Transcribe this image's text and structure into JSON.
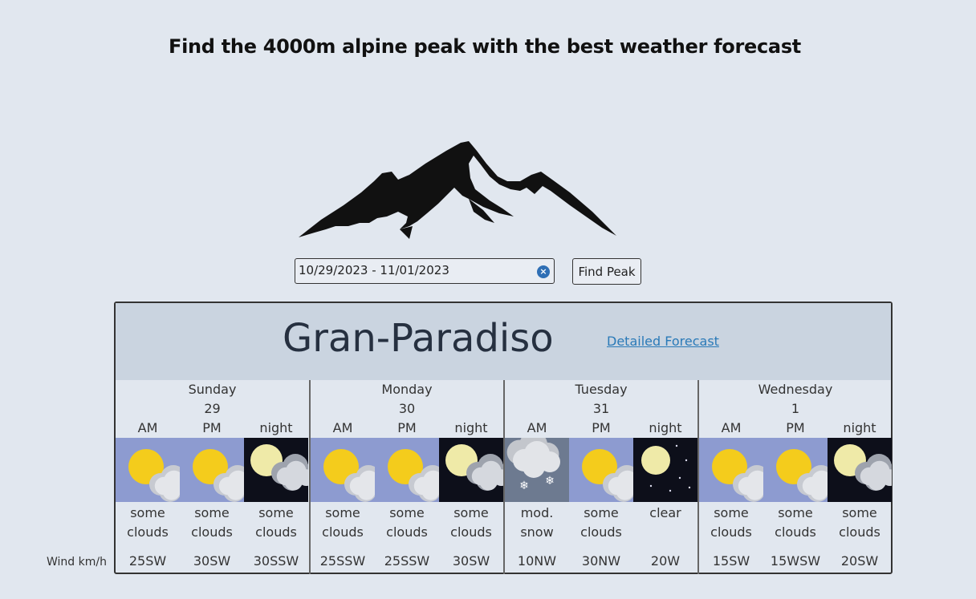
{
  "page": {
    "title": "Find the 4000m alpine peak with the best weather forecast"
  },
  "search": {
    "date_range": "10/29/2023 - 11/01/2023",
    "clear_icon": "clear-icon",
    "find_label": "Find Peak"
  },
  "result": {
    "peak_name": "Gran-Paradiso",
    "detail_link": "Detailed Forecast",
    "wind_label": "Wind km/h",
    "days": [
      {
        "name": "Sunday",
        "date": "29",
        "periods": [
          {
            "label": "AM",
            "icon": "sun-cloud",
            "desc1": "some",
            "desc2": "clouds",
            "wind": "25SW"
          },
          {
            "label": "PM",
            "icon": "sun-cloud",
            "desc1": "some",
            "desc2": "clouds",
            "wind": "30SW"
          },
          {
            "label": "night",
            "icon": "moon-cloud",
            "desc1": "some",
            "desc2": "clouds",
            "wind": "30SSW"
          }
        ]
      },
      {
        "name": "Monday",
        "date": "30",
        "periods": [
          {
            "label": "AM",
            "icon": "sun-cloud",
            "desc1": "some",
            "desc2": "clouds",
            "wind": "25SSW"
          },
          {
            "label": "PM",
            "icon": "sun-cloud",
            "desc1": "some",
            "desc2": "clouds",
            "wind": "25SSW"
          },
          {
            "label": "night",
            "icon": "moon-cloud",
            "desc1": "some",
            "desc2": "clouds",
            "wind": "30SW"
          }
        ]
      },
      {
        "name": "Tuesday",
        "date": "31",
        "periods": [
          {
            "label": "AM",
            "icon": "snow-cloud",
            "desc1": "mod.",
            "desc2": "snow",
            "wind": "10NW"
          },
          {
            "label": "PM",
            "icon": "sun-cloud",
            "desc1": "some",
            "desc2": "clouds",
            "wind": "30NW"
          },
          {
            "label": "night",
            "icon": "moon-clear",
            "desc1": "clear",
            "desc2": "",
            "wind": "20W"
          }
        ]
      },
      {
        "name": "Wednesday",
        "date": "1",
        "periods": [
          {
            "label": "AM",
            "icon": "sun-cloud",
            "desc1": "some",
            "desc2": "clouds",
            "wind": "15SW"
          },
          {
            "label": "PM",
            "icon": "sun-cloud",
            "desc1": "some",
            "desc2": "clouds",
            "wind": "15WSW"
          },
          {
            "label": "night",
            "icon": "moon-cloud",
            "desc1": "some",
            "desc2": "clouds",
            "wind": "20SW"
          }
        ]
      }
    ]
  }
}
